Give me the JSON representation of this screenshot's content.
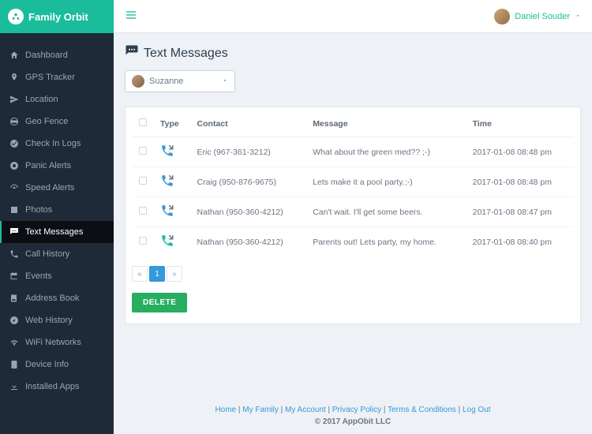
{
  "brand": {
    "name": "Family Orbit"
  },
  "user": {
    "name": "Daniel Souder"
  },
  "page": {
    "title": "Text Messages"
  },
  "family_select": {
    "value": "Suzanne"
  },
  "sidebar": {
    "items": [
      {
        "label": "Dashboard",
        "icon": "home-icon"
      },
      {
        "label": "GPS Tracker",
        "icon": "pin-icon"
      },
      {
        "label": "Location",
        "icon": "send-icon"
      },
      {
        "label": "Geo Fence",
        "icon": "globe-icon"
      },
      {
        "label": "Check In Logs",
        "icon": "check-circle-icon"
      },
      {
        "label": "Panic Alerts",
        "icon": "lifebuoy-icon"
      },
      {
        "label": "Speed Alerts",
        "icon": "gauge-icon"
      },
      {
        "label": "Photos",
        "icon": "image-icon"
      },
      {
        "label": "Text Messages",
        "icon": "speech-icon",
        "active": true
      },
      {
        "label": "Call History",
        "icon": "phone-icon"
      },
      {
        "label": "Events",
        "icon": "calendar-icon"
      },
      {
        "label": "Address Book",
        "icon": "contacts-icon"
      },
      {
        "label": "Web History",
        "icon": "compass-icon"
      },
      {
        "label": "WiFi Networks",
        "icon": "wifi-icon"
      },
      {
        "label": "Device Info",
        "icon": "device-icon"
      },
      {
        "label": "Installed Apps",
        "icon": "download-icon"
      }
    ]
  },
  "table": {
    "headers": {
      "type": "Type",
      "contact": "Contact",
      "message": "Message",
      "time": "Time"
    },
    "rows": [
      {
        "direction": "in",
        "contact": "Eric (967-361-3212)",
        "message": "What about the green med?? ;-)",
        "time": "2017-01-08 08:48 pm"
      },
      {
        "direction": "in",
        "contact": "Craig (950-876-9675)",
        "message": "Lets make it a pool party.;-)",
        "time": "2017-01-08 08:48 pm"
      },
      {
        "direction": "in",
        "contact": "Nathan (950-360-4212)",
        "message": "Can't wait. I'll get some beers.",
        "time": "2017-01-08 08:47 pm"
      },
      {
        "direction": "out",
        "contact": "Nathan (950-360-4212)",
        "message": "Parents out! Lets party, my home.",
        "time": "2017-01-08 08:40 pm"
      }
    ]
  },
  "pager": {
    "prev": "«",
    "page": "1",
    "next": "»"
  },
  "actions": {
    "delete": "DELETE"
  },
  "footer": {
    "links": [
      "Home",
      "My Family",
      "My Account",
      "Privacy Policy",
      "Terms & Conditions",
      "Log Out"
    ],
    "copyright": "© 2017 AppObit LLC"
  }
}
